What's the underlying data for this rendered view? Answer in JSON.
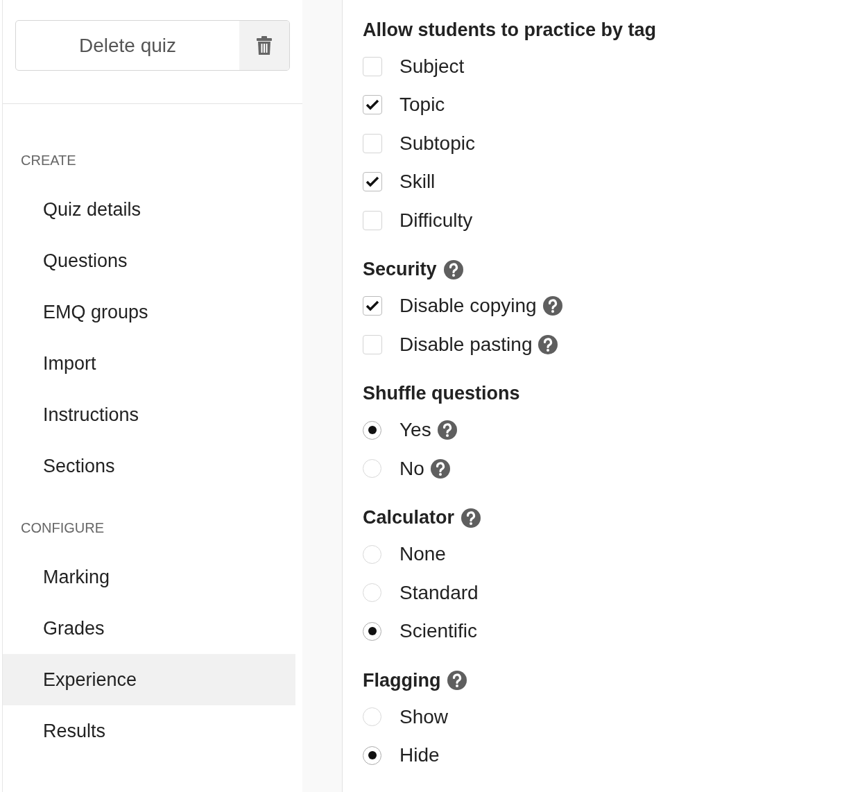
{
  "sidebar": {
    "delete_button": {
      "label": "Delete quiz"
    },
    "sections": [
      {
        "heading": "CREATE",
        "items": [
          {
            "label": "Quiz details",
            "selected": false
          },
          {
            "label": "Questions",
            "selected": false
          },
          {
            "label": "EMQ groups",
            "selected": false
          },
          {
            "label": "Import",
            "selected": false
          },
          {
            "label": "Instructions",
            "selected": false
          },
          {
            "label": "Sections",
            "selected": false
          }
        ]
      },
      {
        "heading": "CONFIGURE",
        "items": [
          {
            "label": "Marking",
            "selected": false
          },
          {
            "label": "Grades",
            "selected": false
          },
          {
            "label": "Experience",
            "selected": true
          },
          {
            "label": "Results",
            "selected": false
          }
        ]
      }
    ]
  },
  "settings": [
    {
      "title": "Allow students to practice by tag",
      "help": false,
      "kind": "checkbox",
      "options": [
        {
          "label": "Subject",
          "checked": false,
          "help": false
        },
        {
          "label": "Topic",
          "checked": true,
          "help": false
        },
        {
          "label": "Subtopic",
          "checked": false,
          "help": false
        },
        {
          "label": "Skill",
          "checked": true,
          "help": false
        },
        {
          "label": "Difficulty",
          "checked": false,
          "help": false
        }
      ]
    },
    {
      "title": "Security",
      "help": true,
      "kind": "checkbox",
      "options": [
        {
          "label": "Disable copying",
          "checked": true,
          "help": true
        },
        {
          "label": "Disable pasting",
          "checked": false,
          "help": true
        }
      ]
    },
    {
      "title": "Shuffle questions",
      "help": false,
      "kind": "radio",
      "options": [
        {
          "label": "Yes",
          "selected": true,
          "help": true
        },
        {
          "label": "No",
          "selected": false,
          "help": true
        }
      ]
    },
    {
      "title": "Calculator",
      "help": true,
      "kind": "radio",
      "options": [
        {
          "label": "None",
          "selected": false,
          "help": false
        },
        {
          "label": "Standard",
          "selected": false,
          "help": false
        },
        {
          "label": "Scientific",
          "selected": true,
          "help": false
        }
      ]
    },
    {
      "title": "Flagging",
      "help": true,
      "kind": "radio",
      "options": [
        {
          "label": "Show",
          "selected": false,
          "help": false
        },
        {
          "label": "Hide",
          "selected": true,
          "help": false
        }
      ]
    }
  ]
}
